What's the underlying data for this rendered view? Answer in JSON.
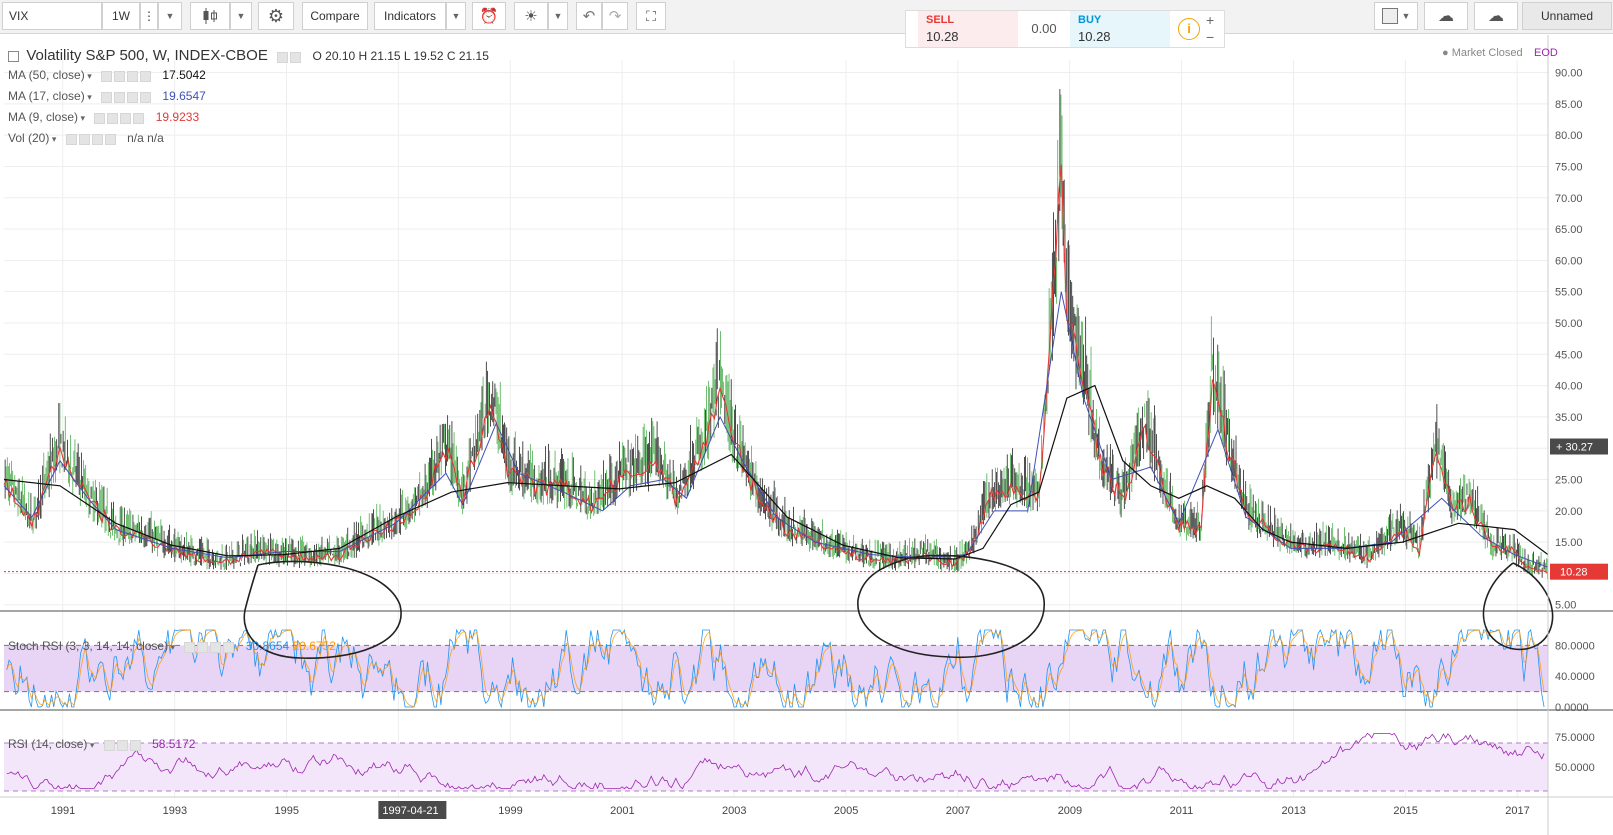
{
  "toolbar": {
    "symbol": "VIX",
    "interval": "1W",
    "compare_label": "Compare",
    "indicators_label": "Indicators",
    "layout_name": "Unnamed"
  },
  "trade": {
    "sell_label": "SELL",
    "sell_price": "10.28",
    "spread": "0.00",
    "buy_label": "BUY",
    "buy_price": "10.28",
    "info_icon": "i",
    "plus": "+",
    "minus": "−"
  },
  "legend": {
    "title": "Volatility S&P 500, W, INDEX-CBOE",
    "ohlc": "O 20.10  H 21.15  L 19.52  C 21.15",
    "ma50_label": "MA (50, close)",
    "ma50_value": "17.5042",
    "ma17_label": "MA (17, close)",
    "ma17_value": "19.6547",
    "ma9_label": "MA (9, close)",
    "ma9_value": "19.9233",
    "vol_label": "Vol (20)",
    "vol_value": "n/a  n/a",
    "stoch_label": "Stoch RSI (3, 3, 14, 14, close)",
    "stoch_k": "30.8654",
    "stoch_d": "20.6752",
    "rsi_label": "RSI (14, close)",
    "rsi_value": "58.5172"
  },
  "status": {
    "market": "Market Closed",
    "eod": "EOD"
  },
  "colors": {
    "price_up": "#4caf50",
    "price_down": "#222222",
    "ma9": "#e53935",
    "ma17": "#3f51b5",
    "ma50": "#111111",
    "stoch_k": "#2196f3",
    "stoch_d": "#ff9800",
    "rsi": "#9c27b0",
    "last_price": "#e53935"
  },
  "chart_data": {
    "type": "candlestick",
    "price_axis": [
      "90.00",
      "85.00",
      "80.00",
      "75.00",
      "70.00",
      "65.00",
      "60.00",
      "55.00",
      "50.00",
      "45.00",
      "40.00",
      "35.00",
      "30.00",
      "25.00",
      "20.00",
      "15.00",
      "10.00",
      "5.00"
    ],
    "price_ylim": [
      4,
      92
    ],
    "x_years": [
      "1991",
      "1993",
      "1995",
      "1997",
      "1999",
      "2001",
      "2003",
      "2005",
      "2007",
      "2009",
      "2011",
      "2013",
      "2015",
      "2017"
    ],
    "x_range": [
      1990.0,
      2017.6
    ],
    "crosshair_date": "1997-04-21",
    "crosshair_price": "30.27",
    "last_price": "10.28",
    "vix_envelope": [
      [
        1990.0,
        25
      ],
      [
        1990.5,
        18
      ],
      [
        1991.0,
        30
      ],
      [
        1991.5,
        22
      ],
      [
        1992.0,
        17
      ],
      [
        1992.5,
        16
      ],
      [
        1993.0,
        14
      ],
      [
        1993.5,
        12.5
      ],
      [
        1994.0,
        12
      ],
      [
        1994.5,
        13.5
      ],
      [
        1995.0,
        13
      ],
      [
        1995.5,
        12.5
      ],
      [
        1996.0,
        13
      ],
      [
        1996.5,
        16
      ],
      [
        1997.0,
        18
      ],
      [
        1997.5,
        22
      ],
      [
        1997.9,
        30
      ],
      [
        1998.2,
        22
      ],
      [
        1998.7,
        38
      ],
      [
        1999.0,
        27
      ],
      [
        1999.5,
        24
      ],
      [
        2000.0,
        24
      ],
      [
        2000.5,
        21
      ],
      [
        2001.0,
        25
      ],
      [
        2001.7,
        28
      ],
      [
        2002.0,
        22
      ],
      [
        2002.5,
        30
      ],
      [
        2002.8,
        40
      ],
      [
        2003.0,
        32
      ],
      [
        2003.5,
        22
      ],
      [
        2004.0,
        17
      ],
      [
        2004.5,
        15.5
      ],
      [
        2005.0,
        13.5
      ],
      [
        2005.5,
        12.5
      ],
      [
        2006.0,
        12
      ],
      [
        2006.5,
        13
      ],
      [
        2007.0,
        11.5
      ],
      [
        2007.3,
        14
      ],
      [
        2007.6,
        22
      ],
      [
        2008.0,
        24
      ],
      [
        2008.5,
        22
      ],
      [
        2008.8,
        60
      ],
      [
        2008.9,
        75
      ],
      [
        2009.0,
        52
      ],
      [
        2009.3,
        42
      ],
      [
        2009.6,
        28
      ],
      [
        2010.0,
        22
      ],
      [
        2010.4,
        33
      ],
      [
        2010.8,
        22
      ],
      [
        2011.0,
        18
      ],
      [
        2011.4,
        17
      ],
      [
        2011.6,
        42
      ],
      [
        2011.9,
        30
      ],
      [
        2012.2,
        20
      ],
      [
        2012.5,
        18
      ],
      [
        2012.9,
        15
      ],
      [
        2013.3,
        14
      ],
      [
        2013.7,
        14.5
      ],
      [
        2014.0,
        14
      ],
      [
        2014.4,
        12.5
      ],
      [
        2014.8,
        16
      ],
      [
        2015.0,
        17
      ],
      [
        2015.3,
        14
      ],
      [
        2015.6,
        30
      ],
      [
        2015.9,
        20
      ],
      [
        2016.2,
        22
      ],
      [
        2016.6,
        14
      ],
      [
        2016.9,
        14
      ],
      [
        2017.2,
        11.5
      ],
      [
        2017.6,
        10.3
      ]
    ],
    "ma50_line": [
      [
        1990.0,
        25
      ],
      [
        1991.0,
        24
      ],
      [
        1992.0,
        18
      ],
      [
        1993.0,
        14.5
      ],
      [
        1994.0,
        12.8
      ],
      [
        1995.0,
        13
      ],
      [
        1996.0,
        14
      ],
      [
        1997.0,
        19
      ],
      [
        1998.0,
        23
      ],
      [
        1999.0,
        24.5
      ],
      [
        2000.0,
        24
      ],
      [
        2001.0,
        23.5
      ],
      [
        2002.0,
        24.5
      ],
      [
        2003.0,
        29
      ],
      [
        2004.0,
        19
      ],
      [
        2005.0,
        14.5
      ],
      [
        2006.0,
        12.5
      ],
      [
        2007.0,
        12.3
      ],
      [
        2007.5,
        14
      ],
      [
        2008.0,
        21
      ],
      [
        2008.5,
        23
      ],
      [
        2009.0,
        38
      ],
      [
        2009.5,
        40
      ],
      [
        2010.0,
        28
      ],
      [
        2010.5,
        24
      ],
      [
        2011.0,
        22
      ],
      [
        2011.5,
        24
      ],
      [
        2012.0,
        22
      ],
      [
        2012.5,
        17
      ],
      [
        2013.0,
        15
      ],
      [
        2014.0,
        14
      ],
      [
        2015.0,
        15
      ],
      [
        2016.0,
        18
      ],
      [
        2017.0,
        17
      ],
      [
        2017.6,
        13
      ]
    ],
    "ma17_line": [
      [
        1990.0,
        24
      ],
      [
        1990.5,
        19
      ],
      [
        1991.0,
        28
      ],
      [
        1991.5,
        22
      ],
      [
        1992.0,
        17
      ],
      [
        1993.0,
        14
      ],
      [
        1994.0,
        12.5
      ],
      [
        1995.0,
        13.5
      ],
      [
        1996.0,
        13.5
      ],
      [
        1997.0,
        18
      ],
      [
        1997.9,
        26
      ],
      [
        1998.2,
        21
      ],
      [
        1998.8,
        34
      ],
      [
        1999.2,
        26
      ],
      [
        2000.0,
        23
      ],
      [
        2000.7,
        20
      ],
      [
        2001.2,
        24
      ],
      [
        2001.8,
        25
      ],
      [
        2002.2,
        22
      ],
      [
        2002.8,
        35
      ],
      [
        2003.2,
        28
      ],
      [
        2003.8,
        19
      ],
      [
        2004.5,
        15
      ],
      [
        2005.5,
        13
      ],
      [
        2006.5,
        12.5
      ],
      [
        2007.2,
        13
      ],
      [
        2007.7,
        20
      ],
      [
        2008.3,
        20
      ],
      [
        2008.9,
        55
      ],
      [
        2009.3,
        38
      ],
      [
        2009.8,
        25
      ],
      [
        2010.5,
        27
      ],
      [
        2011.0,
        18
      ],
      [
        2011.7,
        33
      ],
      [
        2012.2,
        19
      ],
      [
        2013.0,
        14
      ],
      [
        2014.0,
        14
      ],
      [
        2014.8,
        15
      ],
      [
        2015.7,
        22
      ],
      [
        2016.4,
        16
      ],
      [
        2017.0,
        13
      ],
      [
        2017.6,
        11
      ]
    ],
    "stoch_rsi_axis": [
      "80.0000",
      "40.0000",
      "0.0000"
    ],
    "stoch_rsi_band": [
      20,
      80
    ],
    "rsi_axis": [
      "75.0000",
      "50.0000"
    ],
    "rsi_band": [
      30,
      70
    ]
  }
}
